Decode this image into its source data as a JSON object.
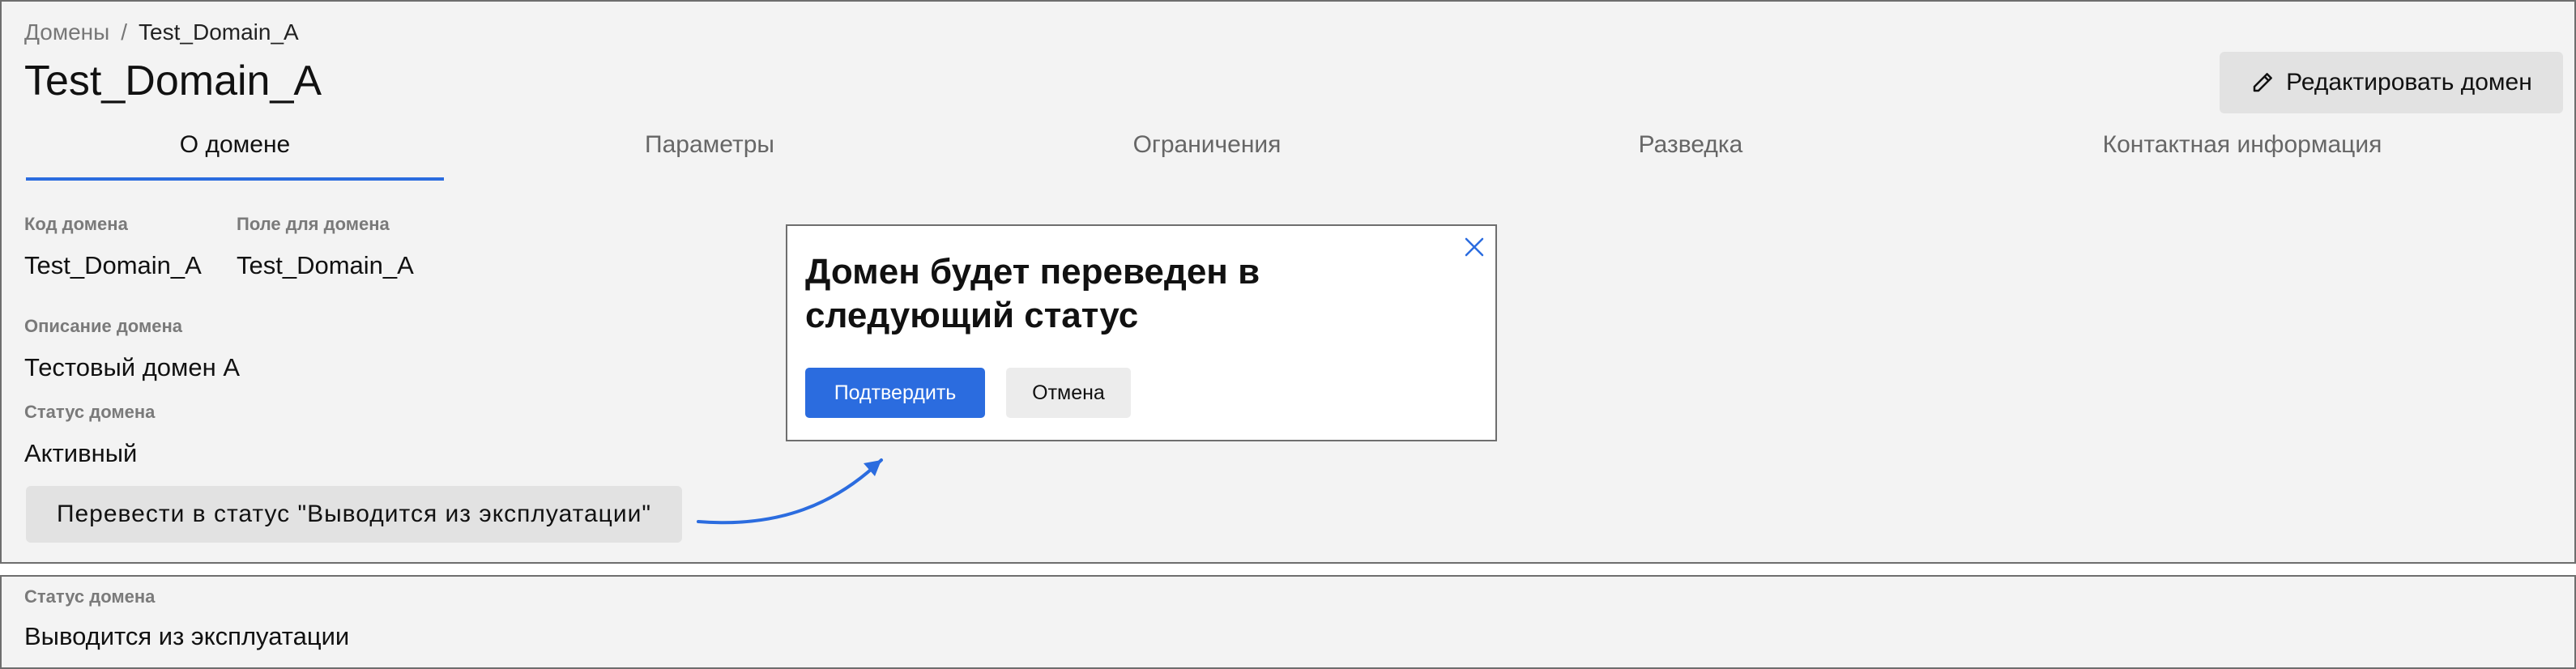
{
  "breadcrumb": {
    "parent": "Домены",
    "separator": "/",
    "current": "Test_Domain_A"
  },
  "page_title": "Test_Domain_A",
  "edit_button": {
    "label": "Редактировать домен",
    "icon": "pencil-icon"
  },
  "tabs": [
    {
      "label": "О домене",
      "active": true
    },
    {
      "label": "Параметры",
      "active": false
    },
    {
      "label": "Ограничения",
      "active": false
    },
    {
      "label": "Разведка",
      "active": false
    },
    {
      "label": "Контактная информация",
      "active": false
    }
  ],
  "fields": {
    "domain_code": {
      "label": "Код домена",
      "value": "Test_Domain_A"
    },
    "domain_field": {
      "label": "Поле для домена",
      "value": "Test_Domain_A"
    },
    "domain_description": {
      "label": "Описание домена",
      "value": "Тестовый домен А"
    },
    "domain_status": {
      "label": "Статус домена",
      "value": "Активный"
    }
  },
  "status_change_button": {
    "label": "Перевести в статус \"Выводится из эксплуатации\""
  },
  "dialog": {
    "title": "Домен будет переведен в следующий статус",
    "confirm_label": "Подтвердить",
    "cancel_label": "Отмена",
    "close_icon": "close-icon"
  },
  "result_panel": {
    "label": "Статус домена",
    "value": "Выводится из эксплуатации"
  },
  "colors": {
    "accent": "#2b6cdf",
    "panel_bg": "#f3f3f3",
    "border": "#6e6e6e"
  }
}
